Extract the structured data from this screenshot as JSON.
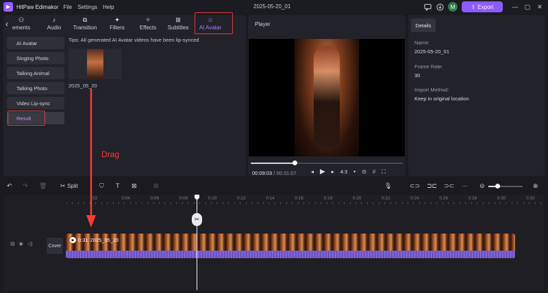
{
  "titlebar": {
    "app_name": "HitPaw Edimakor",
    "menus": [
      "File",
      "Settings",
      "Help"
    ],
    "doc_title": "2025-05-20_01",
    "avatar_initial": "M",
    "export_label": "Export"
  },
  "tabs": [
    {
      "label": "ements",
      "icon": "elements-icon",
      "active": false
    },
    {
      "label": "Audio",
      "icon": "music-note-icon",
      "active": false
    },
    {
      "label": "Transition",
      "icon": "transition-icon",
      "active": false
    },
    {
      "label": "Filters",
      "icon": "sparkle-icon",
      "active": false
    },
    {
      "label": "Effects",
      "icon": "magic-wand-icon",
      "active": false
    },
    {
      "label": "Subtitles",
      "icon": "subtitles-icon",
      "active": false
    },
    {
      "label": "AI Avatar",
      "icon": "avatar-icon",
      "active": true
    }
  ],
  "sidebar": {
    "items": [
      {
        "label": "AI Avatar"
      },
      {
        "label": "Singing Photo"
      },
      {
        "label": "Talking Animal"
      },
      {
        "label": "Talking Photo"
      },
      {
        "label": "Video Lip-sync"
      },
      {
        "label": "Result"
      }
    ]
  },
  "content": {
    "tips": "Tips: All generated AI Avatar videos have been lip-synced",
    "thumb_label": "2025_05_20"
  },
  "player": {
    "title": "Player",
    "current_time": "00:09:03",
    "total_time": "/ 00:31:07",
    "progress": 0.29,
    "ratio": "4:3"
  },
  "details": {
    "tab": "Details",
    "name_label": "Name:",
    "name_value": "2025-05-20_01",
    "frame_rate_label": "Frame Rate:",
    "frame_rate_value": "30",
    "import_method_label": "Import Method:",
    "import_method_value": "Keep in original location"
  },
  "toolbar": {
    "split_label": "Split",
    "zoom_level": 0.25
  },
  "timeline": {
    "ticks": [
      "02",
      "0:04",
      "0:06",
      "0:08",
      "0:10",
      "0:12",
      "0:14",
      "0:16",
      "0:18",
      "0:20",
      "0:22",
      "0:24",
      "0:26",
      "0:28",
      "0:30",
      "0:32"
    ],
    "cover_label": "Cover",
    "clip_duration": "0:31",
    "clip_name": "2025_05_20"
  },
  "annotation": {
    "drag_label": "Drag"
  },
  "colors": {
    "accent": "#8d5cff",
    "highlight_red": "#e23b3b"
  }
}
